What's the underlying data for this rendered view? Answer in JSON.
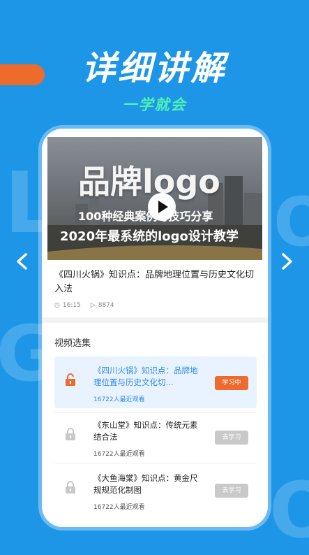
{
  "banner": {
    "headline": "详细讲解",
    "subhead": "一学就会",
    "accent_color": "#ee6b2e",
    "subhead_color": "#4ff0b3"
  },
  "video": {
    "title_big": "品牌logo",
    "line1": "100种经典案例与技巧分享",
    "line2": "2020年最系统的logo设计教学",
    "play_icon": "play-icon"
  },
  "course": {
    "title": "《四川火锅》知识点：品牌地理位置与历史文化切入法",
    "duration": "16:15",
    "plays": "8874"
  },
  "episodes_section": {
    "title": "视频选集",
    "items": [
      {
        "title": "《四川火锅》知识点：品牌地理位置与历史文化切...",
        "views": "16722人最近观看",
        "button": "学习中",
        "locked": false
      },
      {
        "title": "《东山堂》知识点：传统元素结合法",
        "views": "16722人最近观看",
        "button": "去学习",
        "locked": true
      },
      {
        "title": "《大鱼海棠》知识点：黄金尺规规范化制图",
        "views": "16722人最近观看",
        "button": "去学习",
        "locked": true
      }
    ]
  },
  "nav": {
    "prev_icon": "chevron-left-icon",
    "next_icon": "chevron-right-icon"
  }
}
